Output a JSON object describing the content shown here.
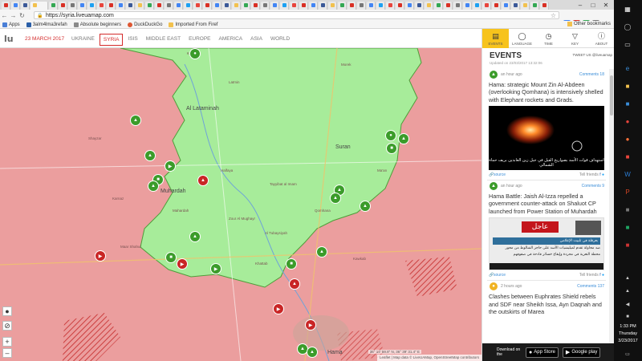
{
  "browser": {
    "url": "https://syria.liveuamap.com",
    "bookmarks": [
      "Apps",
      "3alm4lma3refah",
      "Absolute beginners",
      "DuckDuckGo",
      "Imported From Firef"
    ],
    "other_bookmarks": "Other bookmarks"
  },
  "site": {
    "logo": "lu",
    "date": "23 MARCH 2017",
    "regions": [
      "UKRAINE",
      "SYRIA",
      "ISIS",
      "MIDDLE EAST",
      "EUROPE",
      "AMERICA",
      "ASIA",
      "WORLD"
    ],
    "active_region": "SYRIA"
  },
  "sidebar": {
    "tabs": [
      {
        "label": "EVENTS",
        "icon": "events-icon"
      },
      {
        "label": "LANGUAGE",
        "icon": "speech-bubble-icon"
      },
      {
        "label": "TIME",
        "icon": "clock-icon"
      },
      {
        "label": "KEY",
        "icon": "filter-icon"
      },
      {
        "label": "ABOUT",
        "icon": "info-icon"
      }
    ],
    "title": "EVENTS",
    "tweet_us": "TWEET US @liveuamap",
    "updated": "Updated on 23/03/2017 13:32:06",
    "events": [
      {
        "time": "an hour ago",
        "comments": "Comments 18",
        "text": "Hama: strategic Mount Zin Al-Abdeen (overlooking Qomhana) is intensively shelled with Elephant rockets and Grads.",
        "image_caption": "استهداف قوات الأسد بصواريخ الفيل في جبل زين العابدين بريف حماة الشمالي",
        "source": "source",
        "tell": "Tell friends"
      },
      {
        "time": "an hour ago",
        "comments": "Comments 9",
        "text": "Hama Battle: Jaish Al-Izza repelled a government counter-attack on Shaluot CP launched from Power Station of Muhardah",
        "image_banner": "عاجل",
        "image_lines": [
          "بعرقلة في تلبيت الإعلامي",
          "صد محاولة تقدم لميليشيات الأسد على حاجز الشالوط من محور",
          "محطة التعرية في محردة وإيقاع خسائر فادحة في صفوفهم"
        ],
        "source": "source",
        "tell": "Tell friends"
      },
      {
        "time": "2 hours ago",
        "comments": "Comments 137",
        "text": "Clashes between Euphrates Shield rebels and SDF near Sheikh Issa, Ayn Daqnah and the outskirts of Marea",
        "source": "",
        "tell": ""
      }
    ],
    "download_label": "Download on the",
    "app_store": "App Store",
    "google_play": "Google play"
  },
  "map": {
    "labels": [
      {
        "t": "Kafr Zita",
        "big": false
      },
      {
        "t": "Latmin",
        "big": false
      },
      {
        "t": "Al Lataminah",
        "big": true
      },
      {
        "t": "Morek",
        "big": false
      },
      {
        "t": "Suran",
        "big": true
      },
      {
        "t": "Muhardah",
        "big": true
      },
      {
        "t": "Halfaya",
        "big": false
      },
      {
        "t": "Tayyibat al Imam",
        "big": false
      },
      {
        "t": "Qomhana",
        "big": false
      },
      {
        "t": "Khattab",
        "big": false
      },
      {
        "t": "Hama",
        "big": true
      },
      {
        "t": "Karnaz",
        "big": false
      },
      {
        "t": "Mahardah",
        "big": false
      },
      {
        "t": "Ma'an",
        "big": false
      },
      {
        "t": "Al Tubaysiyah",
        "big": false
      },
      {
        "t": "Kawkab",
        "big": false
      },
      {
        "t": "Maar Shahur",
        "big": false
      },
      {
        "t": "Zour Al Mughayr",
        "big": false
      },
      {
        "t": "Shayzar",
        "big": false
      }
    ],
    "attribution": "Leaflet | Map data © LiveUAMap, OpenStreetMap contributors",
    "coords": "35° 14' 59.8\" N, 36° 39' 31.4\" E"
  },
  "taskbar": {
    "time": "1:33 PM",
    "day": "Thursday",
    "date": "3/23/2017"
  },
  "colors": {
    "rebel_green": "#a7ec9a",
    "government_red": "#eb9e9e",
    "accent_red": "#d42b2b",
    "accent_yellow": "#f7c31c",
    "link_blue": "#3a8dd8"
  }
}
